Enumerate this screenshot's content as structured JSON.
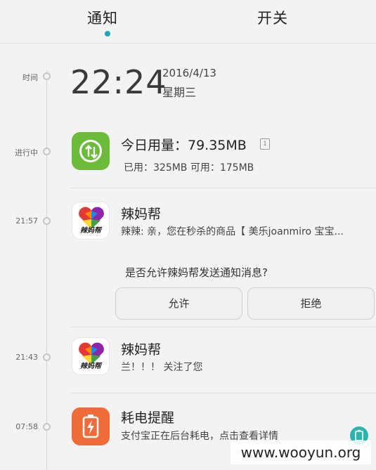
{
  "tabs": {
    "notify": "通知",
    "switch": "开关"
  },
  "timeline": {
    "time_label": "时间",
    "ongoing_label": "进行中",
    "t1": "21:57",
    "t2": "21:43",
    "t3": "07:58"
  },
  "clock": {
    "time": "22:24",
    "date": "2016/4/13",
    "weekday": "星期三"
  },
  "data_card": {
    "title": "今日用量：79.35MB",
    "small_icon_text": "1",
    "subtitle": "已用：325MB  可用：175MB"
  },
  "notif1": {
    "app": "辣妈帮",
    "icon_text": "辣妈帮",
    "message": "辣辣: 亲，您在秒杀的商品【 美乐joanmiro 宝宝..."
  },
  "permission": {
    "question": "是否允许辣妈帮发送通知消息?",
    "allow": "允许",
    "deny": "拒绝"
  },
  "notif2": {
    "app": "辣妈帮",
    "icon_text": "辣妈帮",
    "message": "兰！！！ 关注了您"
  },
  "notif3": {
    "title": "耗电提醒",
    "message": "支付宝正在后台耗电，点击查看详情"
  },
  "watermark": "www.wooyun.org",
  "colors": {
    "accent": "#1ea7b8",
    "data_icon": "#6dbb3b",
    "battery_icon": "#ef6b3a"
  }
}
